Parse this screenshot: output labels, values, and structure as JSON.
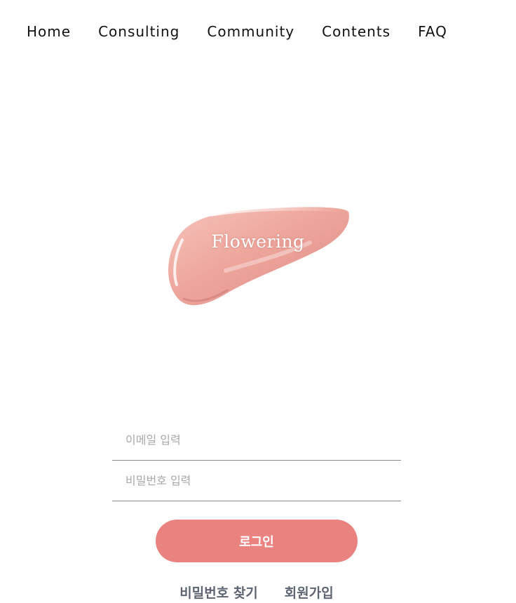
{
  "nav": {
    "items": [
      {
        "label": "Home"
      },
      {
        "label": "Consulting"
      },
      {
        "label": "Community"
      },
      {
        "label": "Contents"
      },
      {
        "label": "FAQ"
      }
    ]
  },
  "logo": {
    "text": "Flowering"
  },
  "form": {
    "email_placeholder": "이메일 입력",
    "email_value": "",
    "password_placeholder": "비밀번호 입력",
    "password_value": "",
    "login_label": "로그인"
  },
  "links": {
    "find_password": "비밀번호 찾기",
    "signup": "회원가입"
  },
  "colors": {
    "accent": "#ea8380",
    "link": "#5f6472",
    "swatch": "#eea69c"
  },
  "icons": {
    "logo_shape": "lip-gloss-swatch"
  }
}
